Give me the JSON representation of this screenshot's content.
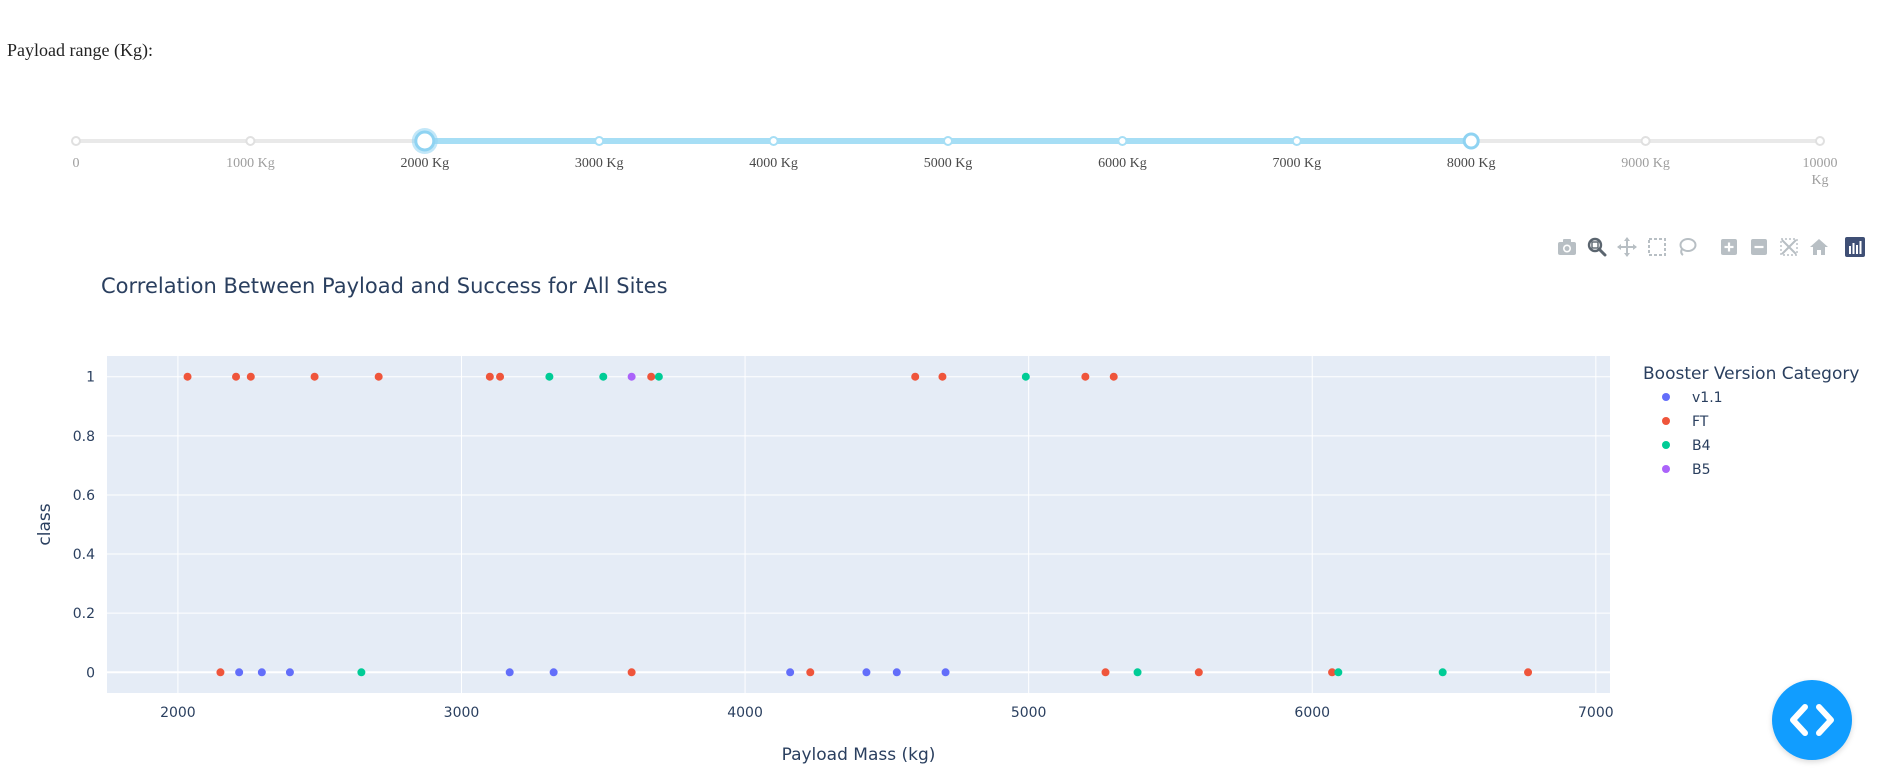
{
  "filter": {
    "label": "Payload range (Kg):"
  },
  "slider": {
    "min": 0,
    "max": 10000,
    "selected": [
      2000,
      8000
    ],
    "marks": [
      {
        "value": 0,
        "label": "0"
      },
      {
        "value": 1000,
        "label": "1000 Kg"
      },
      {
        "value": 2000,
        "label": "2000 Kg"
      },
      {
        "value": 3000,
        "label": "3000 Kg"
      },
      {
        "value": 4000,
        "label": "4000 Kg"
      },
      {
        "value": 5000,
        "label": "5000 Kg"
      },
      {
        "value": 6000,
        "label": "6000 Kg"
      },
      {
        "value": 7000,
        "label": "7000 Kg"
      },
      {
        "value": 8000,
        "label": "8000 Kg"
      },
      {
        "value": 9000,
        "label": "9000 Kg"
      },
      {
        "value": 10000,
        "label": "10000 Kg"
      }
    ],
    "track_color": "#e9e9e9",
    "active_color": "#a6def5",
    "handle_color": "#8fd3f2"
  },
  "toolbar": {
    "buttons": [
      "camera-icon",
      "zoom-icon",
      "pan-icon",
      "box-select-icon",
      "lasso-select-icon",
      "zoom-in-icon",
      "zoom-out-icon",
      "autoscale-icon",
      "reset-axes-icon"
    ],
    "logo": "plotly-logo-icon"
  },
  "chart_data": {
    "type": "scatter",
    "title": "Correlation Between Payload and Success for All Sites",
    "xlabel": "Payload Mass (kg)",
    "ylabel": "class",
    "xlim": [
      1750,
      7050
    ],
    "ylim": [
      -0.07,
      1.07
    ],
    "xticks": [
      2000,
      3000,
      4000,
      5000,
      6000,
      7000
    ],
    "yticks": [
      0,
      0.2,
      0.4,
      0.6,
      0.8,
      1
    ],
    "grid": true,
    "plot_bg": "#e5ecf6",
    "legend": {
      "title": "Booster Version Category",
      "placement": "right"
    },
    "series": [
      {
        "name": "v1.1",
        "color": "#636efa",
        "x": [
          2216,
          2296,
          2395,
          3170,
          3325,
          4159,
          4428,
          4535,
          4707
        ],
        "y": [
          0,
          0,
          0,
          0,
          0,
          0,
          0,
          0,
          0
        ]
      },
      {
        "name": "FT",
        "color": "#ef553b",
        "x": [
          2034,
          2205,
          2257,
          2482,
          2708,
          3100,
          3136,
          3669,
          4600,
          4696,
          5200,
          5300,
          2150,
          3600,
          4230,
          5271,
          5600,
          6070,
          6761
        ],
        "y": [
          1,
          1,
          1,
          1,
          1,
          1,
          1,
          1,
          1,
          1,
          1,
          1,
          0,
          0,
          0,
          0,
          0,
          0,
          0
        ]
      },
      {
        "name": "B4",
        "color": "#00cc96",
        "x": [
          3310,
          3500,
          3696,
          4990,
          2647,
          5384,
          6092,
          6460
        ],
        "y": [
          1,
          1,
          1,
          1,
          0,
          0,
          0,
          0
        ]
      },
      {
        "name": "B5",
        "color": "#ab63fa",
        "x": [
          3600
        ],
        "y": [
          1
        ]
      }
    ]
  }
}
